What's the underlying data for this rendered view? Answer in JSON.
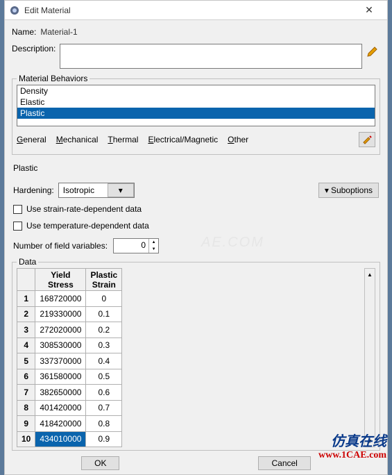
{
  "window": {
    "title": "Edit Material"
  },
  "name": {
    "label": "Name:",
    "value": "Material-1"
  },
  "description": {
    "label": "Description:"
  },
  "behaviors": {
    "legend": "Material Behaviors",
    "items": [
      "Density",
      "Elastic",
      "Plastic"
    ],
    "selected": 2
  },
  "menus": {
    "general": "General",
    "mechanical": "Mechanical",
    "thermal": "Thermal",
    "electrical": "Electrical/Magnetic",
    "other": "Other"
  },
  "section": "Plastic",
  "hardening": {
    "label": "Hardening:",
    "value": "Isotropic"
  },
  "suboptions": "Suboptions",
  "check1": "Use strain-rate-dependent data",
  "check2": "Use temperature-dependent data",
  "numvars": {
    "label": "Number of field variables:",
    "value": "0"
  },
  "data": {
    "legend": "Data",
    "col1": "Yield Stress",
    "col2": "Plastic Strain",
    "rows": [
      {
        "n": "1",
        "a": "168720000",
        "b": "0"
      },
      {
        "n": "2",
        "a": "219330000",
        "b": "0.1"
      },
      {
        "n": "3",
        "a": "272020000",
        "b": "0.2"
      },
      {
        "n": "4",
        "a": "308530000",
        "b": "0.3"
      },
      {
        "n": "5",
        "a": "337370000",
        "b": "0.4"
      },
      {
        "n": "6",
        "a": "361580000",
        "b": "0.5"
      },
      {
        "n": "7",
        "a": "382650000",
        "b": "0.6"
      },
      {
        "n": "8",
        "a": "401420000",
        "b": "0.7"
      },
      {
        "n": "9",
        "a": "418420000",
        "b": "0.8"
      },
      {
        "n": "10",
        "a": "434010000",
        "b": "0.9"
      }
    ],
    "selectedRow": 9
  },
  "buttons": {
    "ok": "OK",
    "cancel": "Cancel"
  },
  "watermark": {
    "cn": "仿真在线",
    "url": "www.1CAE.com"
  },
  "phantom": "AE.COM"
}
